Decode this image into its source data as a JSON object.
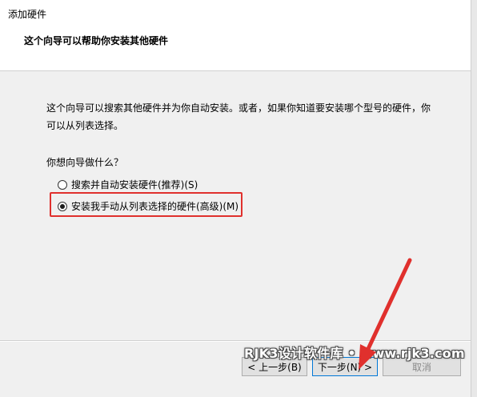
{
  "window": {
    "title": "添加硬件"
  },
  "header": {
    "heading": "这个向导可以帮助你安装其他硬件"
  },
  "main": {
    "intro_line1": "这个向导可以搜索其他硬件并为你自动安装。或者，如果你知道要安装哪个型号的硬件，你",
    "intro_line2": "可以从列表选择。",
    "question": "你想向导做什么？",
    "options": [
      {
        "label": "搜索并自动安装硬件(推荐)(S)",
        "checked": false
      },
      {
        "label": "安装我手动从列表选择的硬件(高级)(M)",
        "checked": true
      }
    ]
  },
  "footer": {
    "back_label": "< 上一步(B)",
    "next_label": "下一步(N) >",
    "cancel_label": "取消"
  },
  "watermark": {
    "text": "RJK3设计软件库 • www.rjk3.com"
  },
  "colors": {
    "highlight": "#e0302d",
    "arrow": "#e0302d"
  }
}
